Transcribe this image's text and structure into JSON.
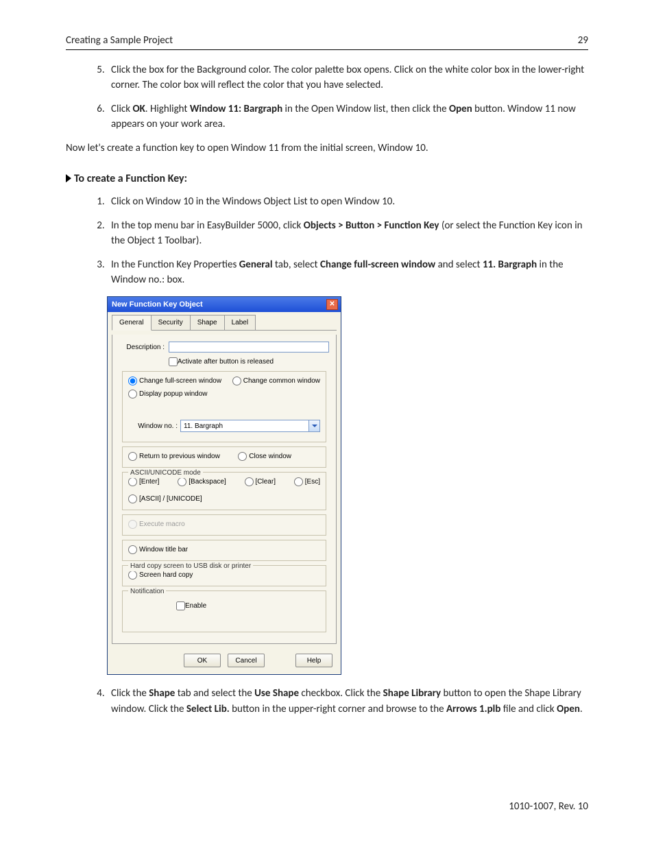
{
  "header": {
    "title": "Creating a Sample Project",
    "page": "29"
  },
  "steps_a": {
    "start": 5,
    "items": [
      "Click the box for the Background color. The color palette box opens. Click on the white color box in the lower-right corner. The color box will reflect the color that you have selected.",
      {
        "pre": "Click ",
        "b1": "OK",
        "mid1": ". Highlight ",
        "b2": "Window 11: Bargraph",
        "mid2": " in the Open Window list, then click the ",
        "b3": "Open",
        "post": " button. Window 11 now appears on your work area."
      }
    ]
  },
  "bridge": "Now let's create a function key to open Window 11 from the initial screen, Window 10.",
  "section": "To create a Function Key:",
  "steps_b": {
    "items": [
      "Click on Window 10 in the Windows Object List to open Window 10.",
      {
        "pre": "In the top menu bar in EasyBuilder 5000, click ",
        "b1": "Objects > Button > Function Key",
        "post": " (or select the Function Key icon in the Object 1 Toolbar)."
      },
      {
        "pre": "In the Function Key Properties ",
        "b1": "General",
        "mid1": " tab, select ",
        "b2": "Change full-screen window",
        "mid2": " and select ",
        "b3": "11. Bargraph",
        "post": " in the Window no.: box."
      }
    ]
  },
  "dialog": {
    "title": "New  Function Key Object",
    "tabs": [
      "General",
      "Security",
      "Shape",
      "Label"
    ],
    "desc_label": "Description :",
    "desc_value": "",
    "activate": "Activate after button is released",
    "r_full": "Change full-screen window",
    "r_common": "Change common window",
    "r_popup": "Display popup window",
    "win_label": "Window no. :",
    "win_value": "11. Bargraph",
    "r_return": "Return to previous window",
    "r_close": "Close window",
    "ascii_group": "ASCII/UNICODE mode",
    "r_enter": "[Enter]",
    "r_backspace": "[Backspace]",
    "r_clear": "[Clear]",
    "r_esc": "[Esc]",
    "r_ascii": "[ASCII] / [UNICODE]",
    "r_macro": "Execute macro",
    "r_titlebar": "Window title bar",
    "hardcopy_group": "Hard copy screen to USB disk or printer",
    "r_hardcopy": "Screen hard copy",
    "notif_group": "Notification",
    "notif_enable": "Enable",
    "ok": "OK",
    "cancel": "Cancel",
    "help": "Help"
  },
  "steps_c": {
    "start": 4,
    "item": {
      "pre": "Click the ",
      "b1": "Shape",
      "mid1": " tab and select the ",
      "b2": "Use Shape",
      "mid2": " checkbox. Click the ",
      "b3": "Shape Library",
      "mid3": " button to open the Shape Library window. Click the ",
      "b4": "Select Lib.",
      "mid4": " button in the upper-right corner and browse to the ",
      "b5": "Arrows 1.plb",
      "mid5": " file and click ",
      "b6": "Open",
      "post": "."
    }
  },
  "footer": "1010-1007, Rev. 10"
}
